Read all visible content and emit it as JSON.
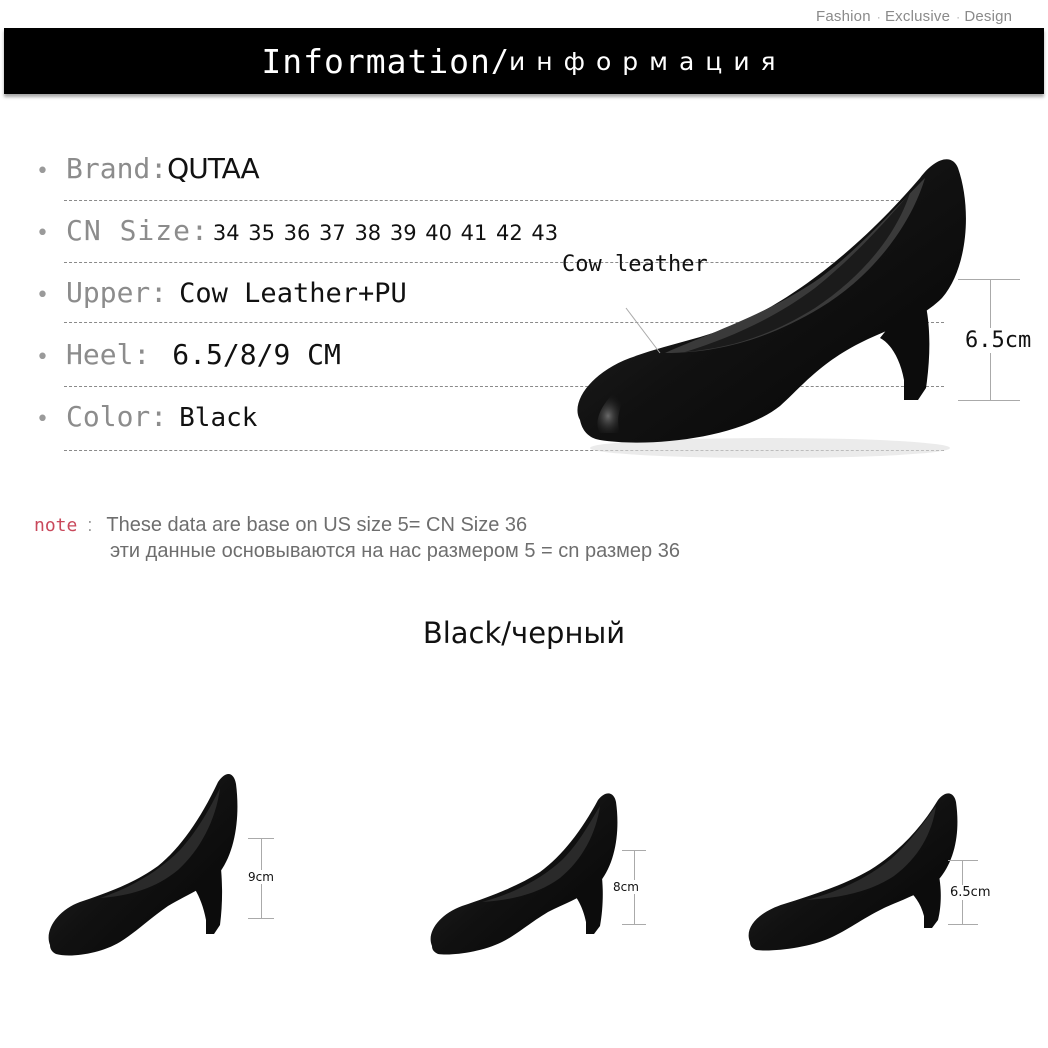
{
  "header": {
    "tagline": [
      "Fashion",
      "Exclusive",
      "Design"
    ],
    "title_en": "Information",
    "title_sep": "/",
    "title_ru": "информация"
  },
  "specs": [
    {
      "label": "Brand:",
      "value": "QUTAA"
    },
    {
      "label": "CN Size:",
      "value": "34 35 36 37 38 39 40 41 42 43"
    },
    {
      "label": "Upper:",
      "value": "Cow Leather+PU"
    },
    {
      "label": "Heel:",
      "value": "6.5/8/9 CM"
    },
    {
      "label": "Color:",
      "value": "Black"
    }
  ],
  "main_shoe": {
    "material_label": "Cow leather",
    "heel_height": "6.5cm"
  },
  "note": {
    "key": "note",
    "colon": ":",
    "en": "These data are base on US size 5= CN Size 36",
    "ru": "эти данные основываются на нас размером 5 = cn размер 36"
  },
  "color_title": "Black/черный",
  "variants": [
    {
      "heel": "9cm"
    },
    {
      "heel": "8cm"
    },
    {
      "heel": "6.5cm"
    }
  ]
}
